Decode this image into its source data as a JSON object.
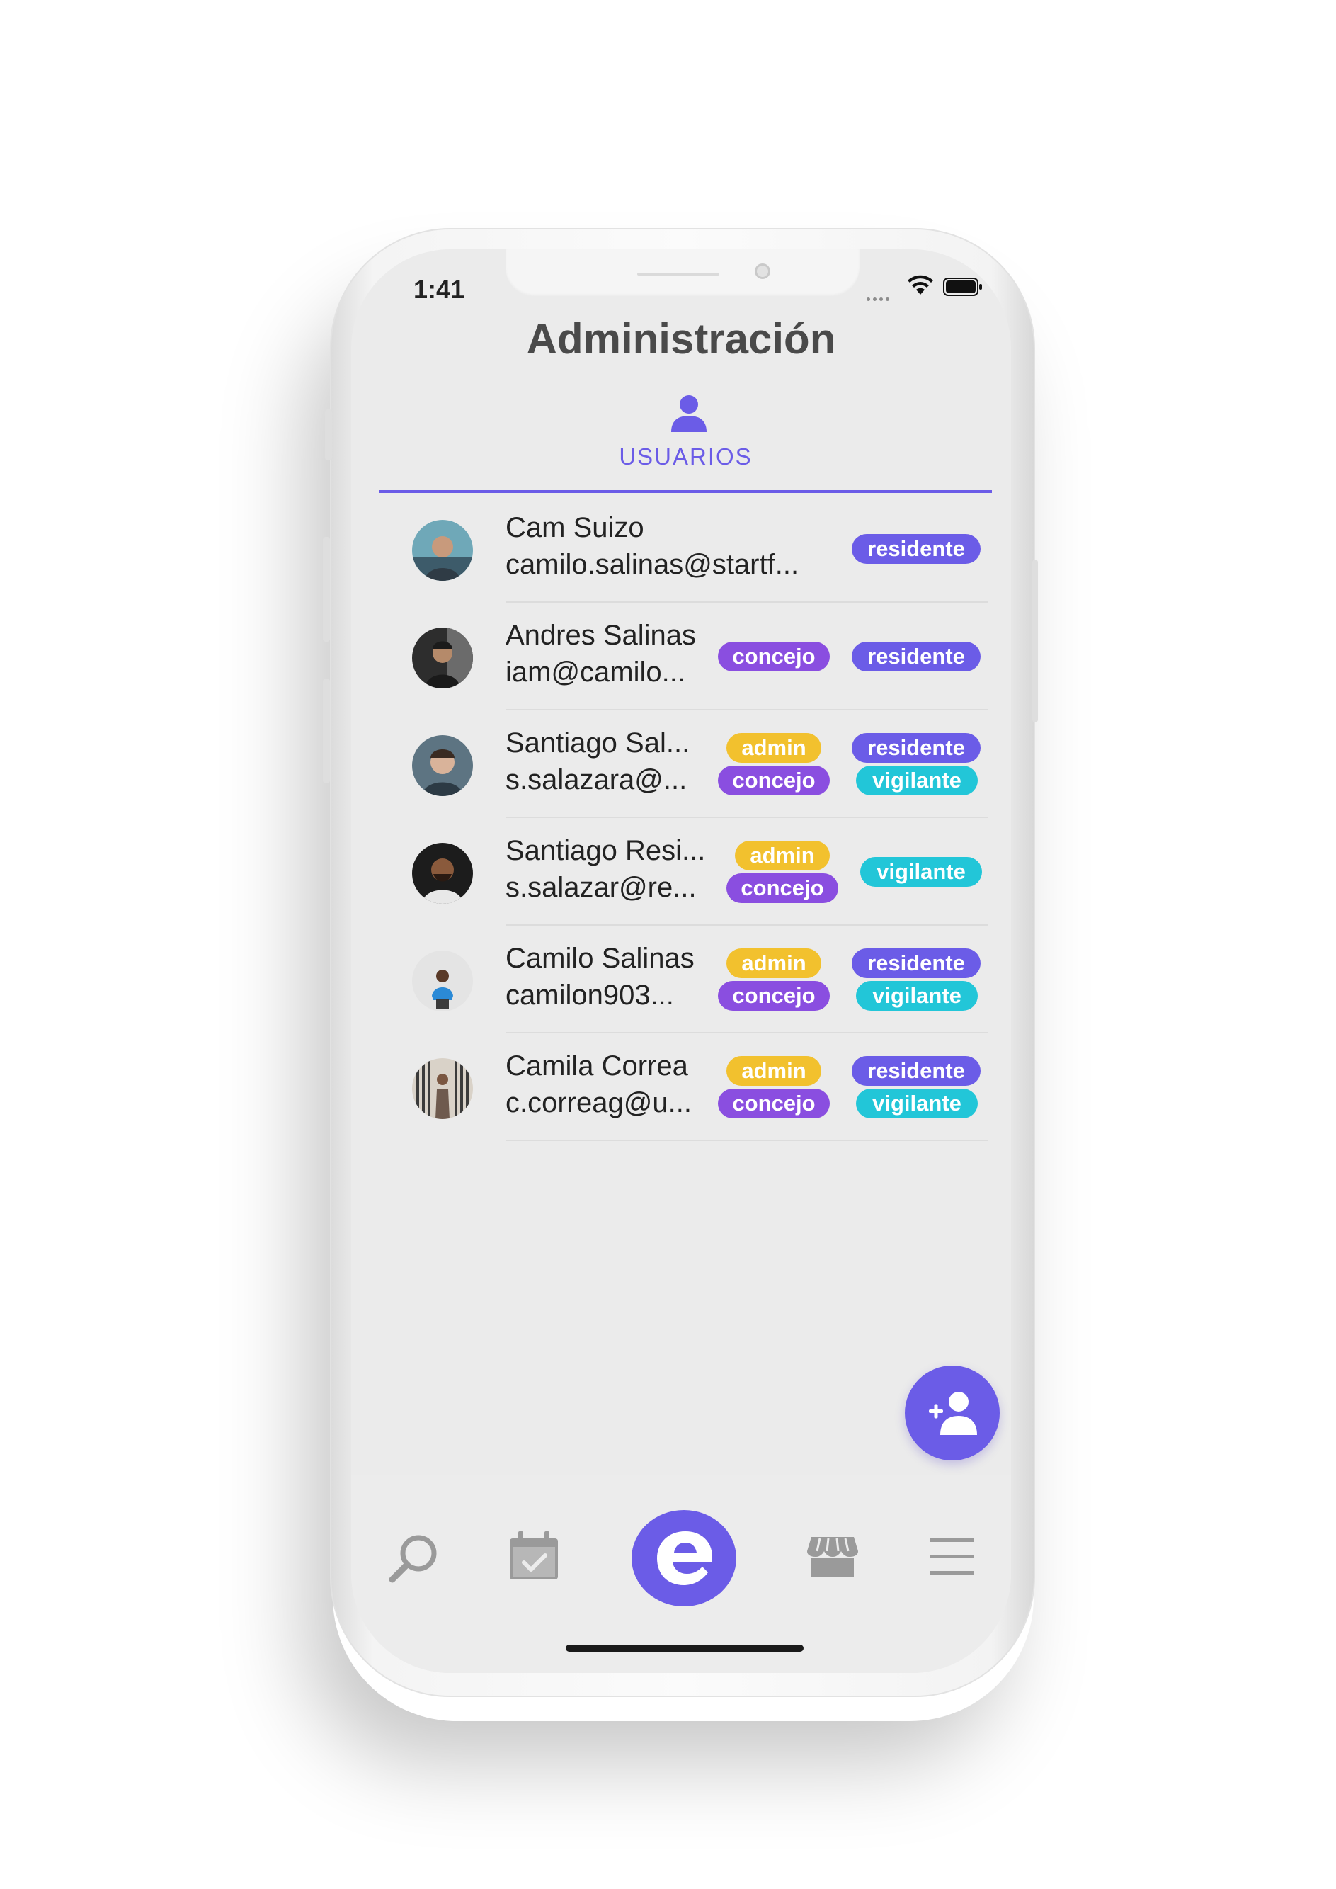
{
  "status_bar": {
    "time": "1:41"
  },
  "header": {
    "title": "Administración"
  },
  "tab": {
    "label": "USUARIOS",
    "icon": "user-icon"
  },
  "users": [
    {
      "name": "Cam Suizo",
      "email": "camilo.salinas@startf...",
      "roles": [
        "residente"
      ]
    },
    {
      "name": "Andres Salinas",
      "email": "iam@camilo...",
      "roles": [
        "concejo",
        "residente"
      ]
    },
    {
      "name": "Santiago Sal...",
      "email": "s.salazara@...",
      "roles": [
        "admin",
        "residente",
        "concejo",
        "vigilante"
      ]
    },
    {
      "name": "Santiago Resi...",
      "email": "s.salazar@re...",
      "roles": [
        "admin",
        "concejo",
        "vigilante"
      ]
    },
    {
      "name": "Camilo Salinas",
      "email": "camilon903...",
      "roles": [
        "admin",
        "residente",
        "concejo",
        "vigilante"
      ]
    },
    {
      "name": "Camila Correa",
      "email": "c.correag@u...",
      "roles": [
        "admin",
        "residente",
        "concejo",
        "vigilante"
      ]
    }
  ],
  "fab": {
    "icon": "add-user-icon"
  },
  "bottom_nav": {
    "items": [
      {
        "icon": "search-icon"
      },
      {
        "icon": "calendar-check-icon"
      },
      {
        "icon": "app-logo-icon"
      },
      {
        "icon": "store-icon"
      },
      {
        "icon": "menu-icon"
      }
    ]
  },
  "colors": {
    "primary": "#6b5ce7",
    "concejo": "#8a4ee0",
    "admin": "#f2c12e",
    "vigilante": "#22c6d8",
    "title_text": "#4a4a4a",
    "screen_bg": "#ebebeb"
  }
}
